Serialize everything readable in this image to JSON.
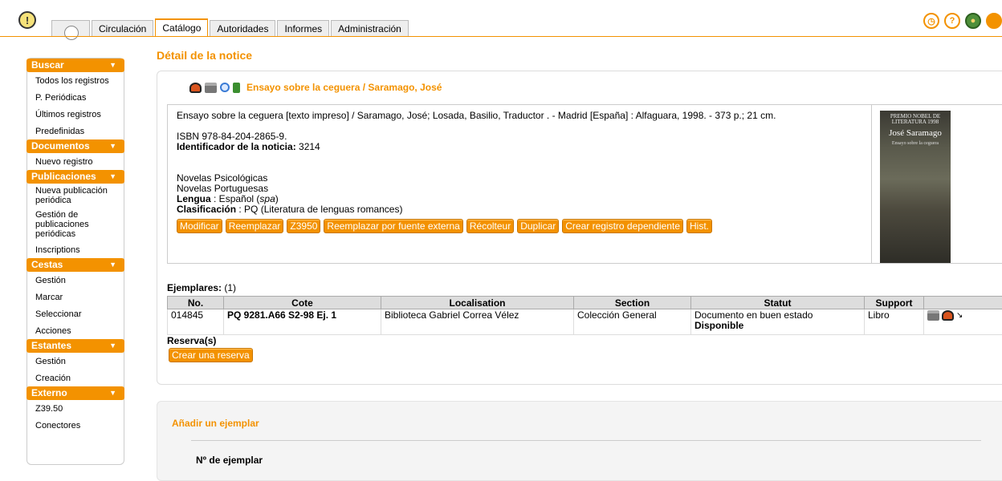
{
  "tabs": [
    {
      "label": "Circulación"
    },
    {
      "label": "Catálogo"
    },
    {
      "label": "Autoridades"
    },
    {
      "label": "Informes"
    },
    {
      "label": "Administración"
    }
  ],
  "sidebar": {
    "buscar": {
      "title": "Buscar",
      "items": [
        "Todos los registros",
        "P. Periódicas",
        "Últimos registros",
        "Predefinidas"
      ]
    },
    "documentos": {
      "title": "Documentos",
      "items": [
        "Nuevo registro"
      ]
    },
    "publicaciones": {
      "title": "Publicaciones",
      "items": [
        "Nueva publicación periódica",
        "Gestión de publicaciones periódicas",
        "Inscriptions"
      ]
    },
    "cestas": {
      "title": "Cestas",
      "items": [
        "Gestión",
        "Marcar",
        "Seleccionar",
        "Acciones"
      ]
    },
    "estantes": {
      "title": "Estantes",
      "items": [
        "Gestión",
        "Creación"
      ]
    },
    "externo": {
      "title": "Externo",
      "items": [
        "Z39.50",
        "Conectores"
      ]
    }
  },
  "page_title": "Détail de la notice",
  "notice": {
    "title": "Ensayo sobre la ceguera / Saramago, José",
    "isbd": "Ensayo sobre la ceguera [texto impreso] / Saramago, José; Losada, Basilio, Traductor . - Madrid [España] : Alfaguara, 1998. - 373 p.; 21 cm.",
    "isbn": "ISBN 978-84-204-2865-9.",
    "id_label": "Identificador de la noticia:",
    "id_value": "3214",
    "subjects": [
      "Novelas Psicológicas",
      "Novelas Portuguesas"
    ],
    "lang_label": "Lengua",
    "lang_value": ": Español (",
    "lang_code": "spa",
    "lang_close": ")",
    "class_label": "Clasificación",
    "class_value": ": PQ (Literatura de lenguas romances)",
    "cover": {
      "line1": "PREMIO NOBEL DE LITERATURA 1998",
      "line2": "José Saramago",
      "line3": "Ensayo sobre la ceguera"
    }
  },
  "buttons": [
    "Modificar",
    "Reemplazar",
    "Z3950",
    "Reemplazar por fuente externa",
    "Récolteur",
    "Duplicar",
    "Crear registro dependiente",
    "Hist."
  ],
  "ejemplares": {
    "label": "Ejemplares:",
    "count": "(1)",
    "headers": [
      "No.",
      "Cote",
      "Localisation",
      "Section",
      "Statut",
      "Support"
    ],
    "row": {
      "no": "014845",
      "cote": "PQ 9281.A66 S2-98 Ej. 1",
      "localisation": "Biblioteca Gabriel Correa Vélez",
      "section": "Colección General",
      "statut": "Documento en buen estado",
      "statut2": "Disponible",
      "support": "Libro"
    }
  },
  "reserva": {
    "label": "Reserva(s)",
    "button": "Crear una reserva"
  },
  "add_ejemplar": {
    "title": "Añadir un ejemplar",
    "field": "Nº de ejemplar"
  }
}
